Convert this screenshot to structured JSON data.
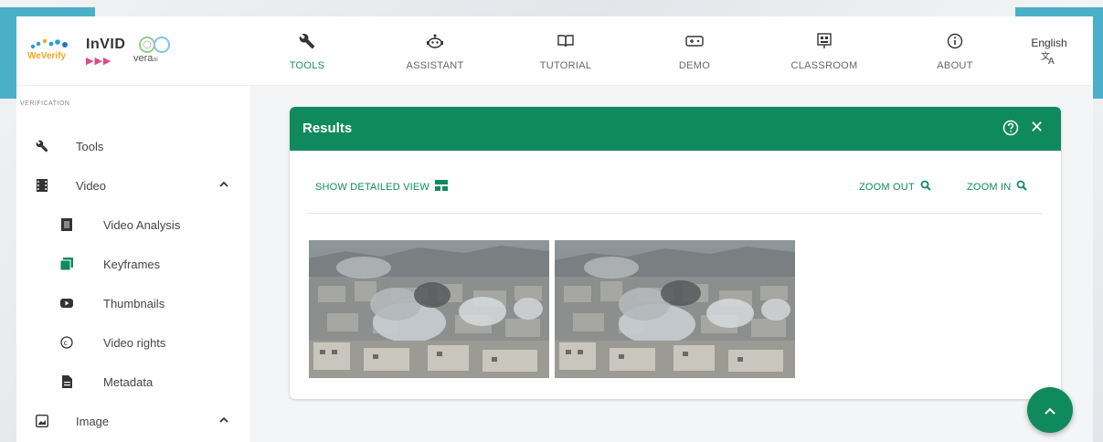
{
  "colors": {
    "primary_green": "#0f8a5f",
    "teal_frame": "#4aafc8",
    "weverify_orange": "#f5a623",
    "invid_pink": "#e04a8d"
  },
  "logo": {
    "weverify": "WeVerify",
    "invid": "InVID",
    "vera": "vera"
  },
  "nav": [
    {
      "label": "TOOLS",
      "icon": "wrench-icon",
      "active": true
    },
    {
      "label": "ASSISTANT",
      "icon": "robot-icon",
      "active": false
    },
    {
      "label": "TUTORIAL",
      "icon": "book-icon",
      "active": false
    },
    {
      "label": "DEMO",
      "icon": "gamepad-icon",
      "active": false
    },
    {
      "label": "CLASSROOM",
      "icon": "classroom-icon",
      "active": false
    },
    {
      "label": "ABOUT",
      "icon": "info-icon",
      "active": false
    }
  ],
  "language": {
    "label": "English",
    "icon": "translate-icon"
  },
  "sidebar": {
    "section_title": "VERIFICATION",
    "items": [
      {
        "label": "Tools",
        "icon": "wrench-icon",
        "level": 0
      },
      {
        "label": "Video",
        "icon": "film-icon",
        "level": 0,
        "expanded": true
      },
      {
        "label": "Video Analysis",
        "icon": "video-analysis-icon",
        "level": 1
      },
      {
        "label": "Keyframes",
        "icon": "keyframes-icon",
        "level": 1,
        "active": true
      },
      {
        "label": "Thumbnails",
        "icon": "youtube-icon",
        "level": 1
      },
      {
        "label": "Video rights",
        "icon": "copyright-icon",
        "level": 1
      },
      {
        "label": "Metadata",
        "icon": "document-icon",
        "level": 1
      },
      {
        "label": "Image",
        "icon": "image-icon",
        "level": 0,
        "expanded": true
      }
    ]
  },
  "results": {
    "title": "Results",
    "show_detailed_view": "SHOW DETAILED VIEW",
    "zoom_out": "ZOOM OUT",
    "zoom_in": "ZOOM IN",
    "keyframe_count": 2
  }
}
